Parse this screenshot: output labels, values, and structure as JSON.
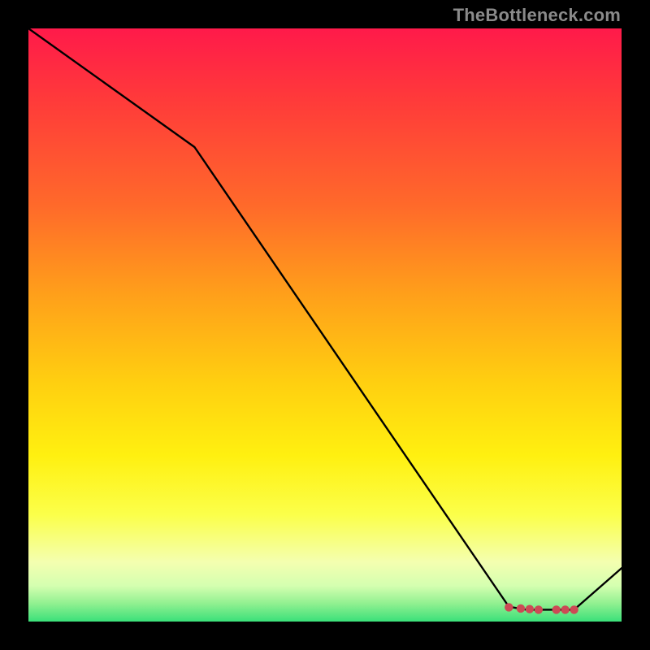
{
  "watermark": "TheBottleneck.com",
  "chart_data": {
    "type": "line",
    "title": "",
    "xlabel": "",
    "ylabel": "",
    "xlim": [
      0,
      100
    ],
    "ylim": [
      0,
      100
    ],
    "series": [
      {
        "name": "curve",
        "x": [
          0,
          28,
          81,
          84,
          92,
          100
        ],
        "values": [
          100,
          80,
          2.5,
          2,
          2,
          9
        ]
      }
    ],
    "markers": {
      "name": "points",
      "x": [
        81,
        83,
        84.5,
        86,
        89,
        90.5,
        92
      ],
      "values": [
        2.4,
        2.2,
        2.1,
        2.0,
        2.0,
        2.0,
        2.0
      ],
      "color": "#cc4a55"
    },
    "colors": {
      "line": "#000000",
      "marker": "#cc4a55"
    }
  }
}
